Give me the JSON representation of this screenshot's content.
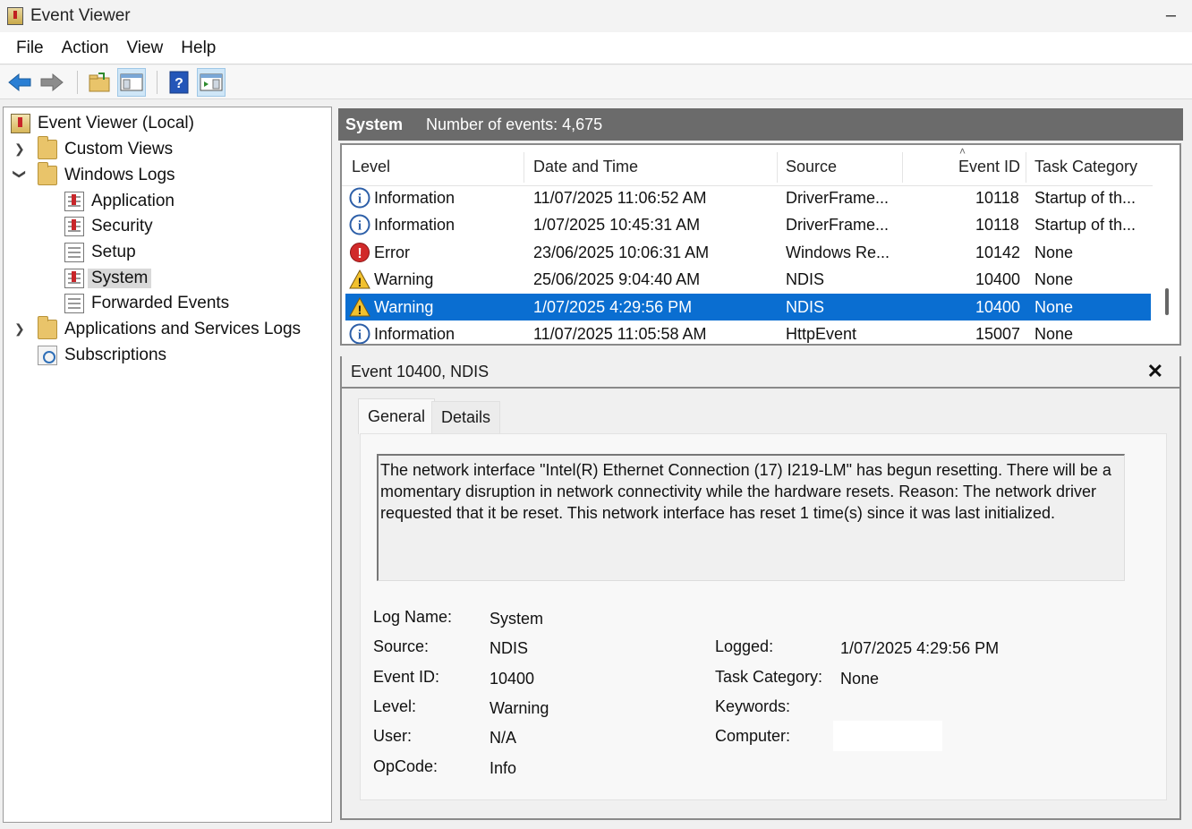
{
  "window": {
    "title": "Event Viewer",
    "minimize_glyph": "–"
  },
  "menu": [
    "File",
    "Action",
    "View",
    "Help"
  ],
  "toolbar": {
    "buttons": [
      "back-arrow-icon",
      "forward-arrow-icon",
      "open-folder-icon",
      "show-hide-tree-icon",
      "help-icon",
      "show-hide-action-pane-icon"
    ]
  },
  "tree": {
    "root": "Event Viewer (Local)",
    "custom_views": "Custom Views",
    "windows_logs": "Windows Logs",
    "logs": [
      "Application",
      "Security",
      "Setup",
      "System",
      "Forwarded Events"
    ],
    "apps_services": "Applications and Services Logs",
    "subscriptions": "Subscriptions",
    "selected": "System"
  },
  "list_header": {
    "log_name": "System",
    "count_text": "Number of events: 4,675"
  },
  "columns": [
    "Level",
    "Date and Time",
    "Source",
    "Event ID",
    "Task Category"
  ],
  "events": [
    {
      "level": "Information",
      "date": "11/07/2025 11:06:52 AM",
      "source": "DriverFrame...",
      "event_id": "10118",
      "task": "Startup of th..."
    },
    {
      "level": "Information",
      "date": "1/07/2025 10:45:31 AM",
      "source": "DriverFrame...",
      "event_id": "10118",
      "task": "Startup of th..."
    },
    {
      "level": "Error",
      "date": "23/06/2025 10:06:31 AM",
      "source": "Windows Re...",
      "event_id": "10142",
      "task": "None"
    },
    {
      "level": "Warning",
      "date": "25/06/2025 9:04:40 AM",
      "source": "NDIS",
      "event_id": "10400",
      "task": "None"
    },
    {
      "level": "Warning",
      "date": "1/07/2025 4:29:56 PM",
      "source": "NDIS",
      "event_id": "10400",
      "task": "None",
      "selected": true
    },
    {
      "level": "Information",
      "date": "11/07/2025 11:05:58 AM",
      "source": "HttpEvent",
      "event_id": "15007",
      "task": "None"
    }
  ],
  "detail": {
    "title": "Event 10400, NDIS",
    "close_glyph": "✕",
    "tabs": [
      "General",
      "Details"
    ],
    "description": "The network interface \"Intel(R) Ethernet Connection (17) I219-LM\" has begun resetting.  There will be a momentary disruption in network connectivity while the hardware resets. Reason: The network driver requested that it be reset. This network interface has reset 1 time(s) since it was last initialized.",
    "fields": {
      "log_name_label": "Log Name:",
      "log_name": "System",
      "source_label": "Source:",
      "source": "NDIS",
      "event_id_label": "Event ID:",
      "event_id": "10400",
      "level_label": "Level:",
      "level": "Warning",
      "user_label": "User:",
      "user": "N/A",
      "opcode_label": "OpCode:",
      "opcode": "Info",
      "logged_label": "Logged:",
      "logged": "1/07/2025 4:29:56 PM",
      "task_category_label": "Task Category:",
      "task_category": "None",
      "keywords_label": "Keywords:",
      "keywords": "",
      "computer_label": "Computer:",
      "computer": ""
    }
  },
  "colors": {
    "selection": "#0a6ed1",
    "header_bar": "#6b6b6b"
  }
}
